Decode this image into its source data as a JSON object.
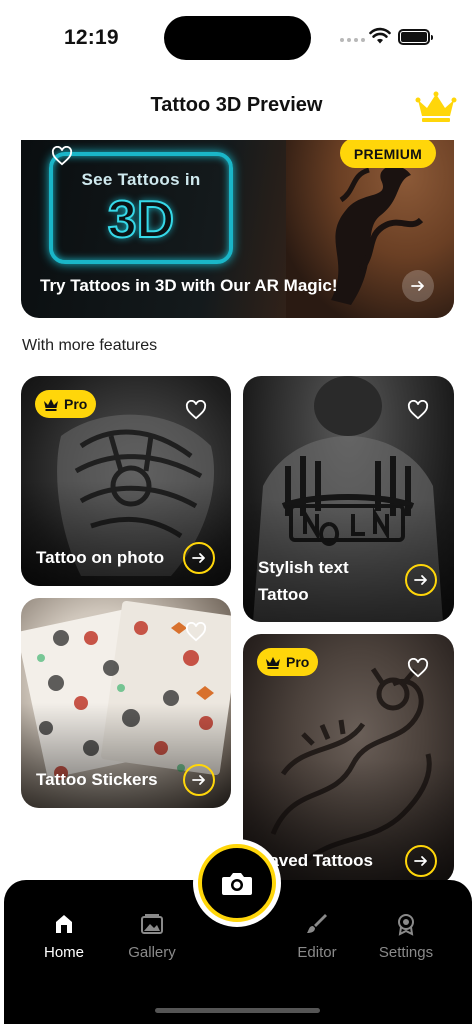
{
  "status_bar": {
    "time": "12:19"
  },
  "header": {
    "title": "Tattoo 3D Preview"
  },
  "hero": {
    "neon_line1": "See Tattoos in",
    "neon_line2": "3D",
    "badge": "PREMIUM",
    "caption": "Try Tattoos in 3D with Our AR Magic!"
  },
  "section": {
    "label": "With more features"
  },
  "cards": [
    {
      "title": "Tattoo on photo",
      "badge": "Pro"
    },
    {
      "title_line1": "Stylish text",
      "title_line2": "Tattoo"
    },
    {
      "title": "Tattoo Stickers"
    },
    {
      "title": "Saved Tattoos",
      "badge": "Pro"
    }
  ],
  "tabs": [
    {
      "label": "Home",
      "icon": "home-icon",
      "active": true
    },
    {
      "label": "Gallery",
      "icon": "gallery-icon",
      "active": false
    },
    {
      "label": "Editor",
      "icon": "brush-icon",
      "active": false
    },
    {
      "label": "Settings",
      "icon": "badge-icon",
      "active": false
    }
  ],
  "colors": {
    "accent": "#ffd60a",
    "neon": "#1ab6c8",
    "tab_bar": "#000000"
  }
}
